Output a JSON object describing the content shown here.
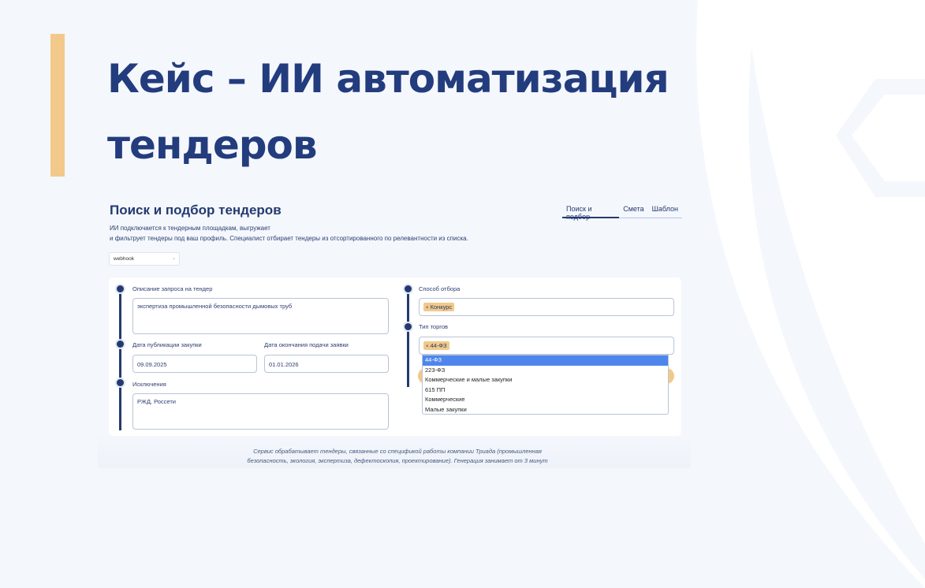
{
  "slide": {
    "title_line1": "Кейс – ИИ автоматизация",
    "title_line2": "тендеров",
    "accent_color": "#f2c98a",
    "title_color": "#233c7d"
  },
  "app": {
    "title": "Поиск и подбор тендеров",
    "description_line1": "ИИ подключается к тендерным площадкам, выгружает",
    "description_line2": "и фильтрует тендеры под ваш профиль. Специалист отбирает тендеры из отсортированного по релевантности из списка.",
    "tabs": [
      {
        "label": "Поиск и подбор",
        "active": true
      },
      {
        "label": "Смета",
        "active": false
      },
      {
        "label": "Шаблон",
        "active": false
      }
    ],
    "mode_select": {
      "value": "webhook",
      "icon": "chevron-down-icon"
    },
    "form": {
      "request_label": "Описание запроса на тендер",
      "request_value": "экспертиза промышленной безопасности дымовых труб",
      "pub_date_label": "Дата публикации закупки",
      "pub_date_value": "09.09.2025",
      "end_date_label": "Дата окончания подачи заявки",
      "end_date_value": "01.01.2026",
      "exclusions_label": "Исключения",
      "exclusions_value": "РЖД, Россети",
      "method_label": "Способ отбора",
      "method_chip": "Конкурс",
      "type_label": "Тип торгов",
      "type_chip": "44-ФЗ",
      "chip_remove": "×",
      "type_options": [
        "44-ФЗ",
        "223-ФЗ",
        "Коммерческие и малые закупки",
        "615 ПП",
        "Коммерческие",
        "Малые закупки"
      ],
      "type_selected": "44-ФЗ"
    },
    "footnote_line1": "Сервис обрабатывает тендеры, связанные со спецификой работы компании Триада (промышленная",
    "footnote_line2": "безопасность, экология, экспертиза, дефектоскопия, проектирование). Генерация занимает от 3 минут",
    "primary_color": "#243a6f",
    "highlight_color": "#4e86ee"
  }
}
